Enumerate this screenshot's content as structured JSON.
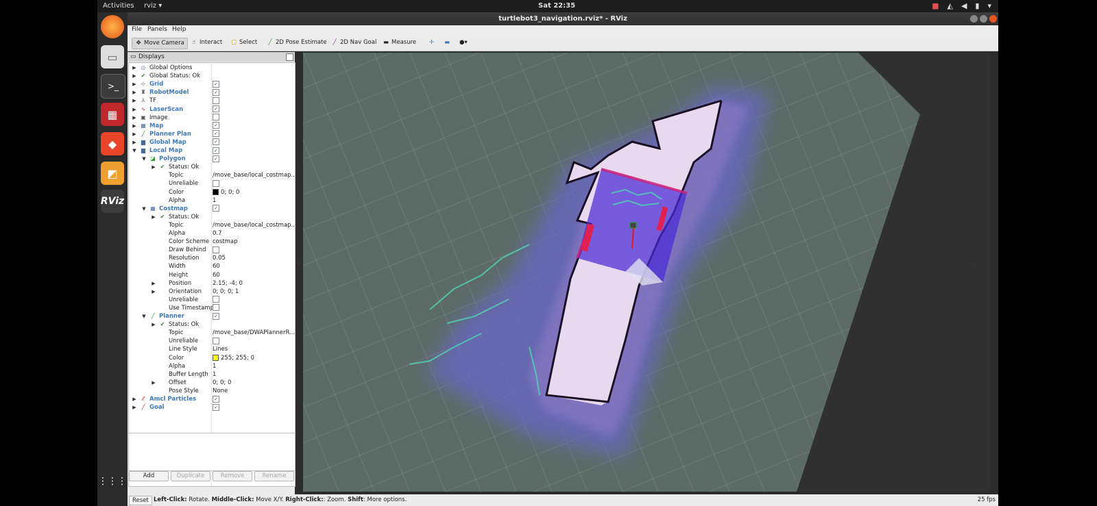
{
  "topbar": {
    "activities": "Activities",
    "app_menu": "rviz ▾",
    "clock": "Sat 22:35"
  },
  "window": {
    "title": "turtlebot3_navigation.rviz* - RViz"
  },
  "menu": {
    "file": "File",
    "panels": "Panels",
    "help": "Help"
  },
  "toolbar": {
    "move_camera": "Move Camera",
    "interact": "Interact",
    "select": "Select",
    "pose_estimate": "2D Pose Estimate",
    "nav_goal": "2D Nav Goal",
    "measure": "Measure"
  },
  "panel": {
    "title": "Displays",
    "rows": [
      {
        "name": "Global Options",
        "value": ""
      },
      {
        "name": "Global Status: Ok",
        "value": ""
      },
      {
        "name": "Grid",
        "value": ""
      },
      {
        "name": "RobotModel",
        "value": ""
      },
      {
        "name": "TF",
        "value": ""
      },
      {
        "name": "LaserScan",
        "value": ""
      },
      {
        "name": "Image",
        "value": ""
      },
      {
        "name": "Map",
        "value": ""
      },
      {
        "name": "Planner Plan",
        "value": ""
      },
      {
        "name": "Global Map",
        "value": ""
      },
      {
        "name": "Local Map",
        "value": ""
      },
      {
        "name": "Polygon",
        "value": ""
      },
      {
        "name": "Status: Ok",
        "value": ""
      },
      {
        "name": "Topic",
        "value": "/move_base/local_costmap..."
      },
      {
        "name": "Unreliable",
        "value": ""
      },
      {
        "name": "Color",
        "value": "0; 0; 0"
      },
      {
        "name": "Alpha",
        "value": "1"
      },
      {
        "name": "Costmap",
        "value": ""
      },
      {
        "name": "Status: Ok",
        "value": ""
      },
      {
        "name": "Topic",
        "value": "/move_base/local_costmap..."
      },
      {
        "name": "Alpha",
        "value": "0.7"
      },
      {
        "name": "Color Scheme",
        "value": "costmap"
      },
      {
        "name": "Draw Behind",
        "value": ""
      },
      {
        "name": "Resolution",
        "value": "0.05"
      },
      {
        "name": "Width",
        "value": "60"
      },
      {
        "name": "Height",
        "value": "60"
      },
      {
        "name": "Position",
        "value": "2.15; -4; 0"
      },
      {
        "name": "Orientation",
        "value": "0; 0; 0; 1"
      },
      {
        "name": "Unreliable",
        "value": ""
      },
      {
        "name": "Use Timestamp",
        "value": ""
      },
      {
        "name": "Planner",
        "value": ""
      },
      {
        "name": "Status: Ok",
        "value": ""
      },
      {
        "name": "Topic",
        "value": "/move_base/DWAPlannerR..."
      },
      {
        "name": "Unreliable",
        "value": ""
      },
      {
        "name": "Line Style",
        "value": "Lines"
      },
      {
        "name": "Color",
        "value": "255; 255; 0"
      },
      {
        "name": "Alpha",
        "value": "1"
      },
      {
        "name": "Buffer Length",
        "value": "1"
      },
      {
        "name": "Offset",
        "value": "0; 0; 0"
      },
      {
        "name": "Pose Style",
        "value": "None"
      },
      {
        "name": "Amcl Particles",
        "value": ""
      },
      {
        "name": "Goal",
        "value": ""
      }
    ],
    "buttons": {
      "add": "Add",
      "duplicate": "Duplicate",
      "remove": "Remove",
      "rename": "Rename"
    }
  },
  "statusbar": {
    "reset": "Reset",
    "left_click": "Left-Click:",
    "left_desc": " Rotate. ",
    "middle_click": "Middle-Click:",
    "middle_desc": " Move X/Y. ",
    "right_click": "Right-Click:",
    "right_desc": ": Zoom. ",
    "shift": "Shift",
    "shift_desc": ": More options.",
    "fps": "25 fps"
  },
  "colors": {
    "accent_blue": "#3d78b9",
    "dock_bg": "#2b2b2b",
    "viewport_floor": "#5c6b66"
  }
}
